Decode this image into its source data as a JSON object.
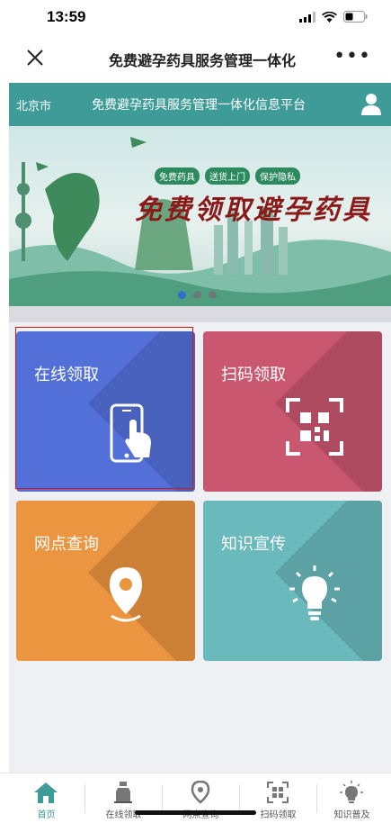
{
  "status_bar": {
    "time": "13:59"
  },
  "navbar": {
    "title": "免费避孕药具服务管理一体化"
  },
  "app_header": {
    "city": "北京市",
    "title": "免费避孕药具服务管理一体化信息平台"
  },
  "banner": {
    "tags": [
      "免费药具",
      "送货上门",
      "保护隐私"
    ],
    "headline": "免费领取避孕药具",
    "slide_count": 3,
    "active_slide": 1
  },
  "tiles": [
    {
      "label": "在线领取",
      "icon": "phone-touch-icon",
      "color": "#5270d8"
    },
    {
      "label": "扫码领取",
      "icon": "qr-scan-icon",
      "color": "#c9576f"
    },
    {
      "label": "网点查询",
      "icon": "location-pin-icon",
      "color": "#ec9540"
    },
    {
      "label": "知识宣传",
      "icon": "lightbulb-icon",
      "color": "#6ab9bc"
    }
  ],
  "tabbar": {
    "items": [
      {
        "label": "首页",
        "icon": "home-icon"
      },
      {
        "label": "在线领取",
        "icon": "bottle-icon"
      },
      {
        "label": "网点查询",
        "icon": "location-pin-icon"
      },
      {
        "label": "扫码领取",
        "icon": "qr-scan-icon"
      },
      {
        "label": "知识普及",
        "icon": "lightbulb-icon"
      }
    ],
    "active_index": 0
  },
  "accent_color": "#3f9b98"
}
